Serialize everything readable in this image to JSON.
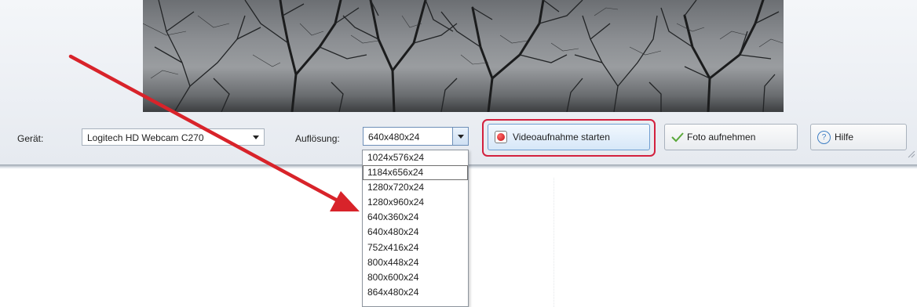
{
  "toolbar": {
    "device_label": "Gerät:",
    "device_value": "Logitech HD Webcam C270",
    "resolution_label": "Auflösung:",
    "resolution_value": "640x480x24",
    "record_button": "Videoaufnahme starten",
    "photo_button": "Foto aufnehmen",
    "help_button": "Hilfe"
  },
  "resolution_options": [
    "1024x576x24",
    "1184x656x24",
    "1280x720x24",
    "1280x960x24",
    "640x360x24",
    "640x480x24",
    "752x416x24",
    "800x448x24",
    "800x600x24",
    "864x480x24"
  ],
  "highlighted_option": "1184x656x24",
  "colors": {
    "highlight_box": "#d3213e",
    "arrow": "#d8232a",
    "record_dot": "#c40f12",
    "photo_check": "#5aa83a",
    "help_icon": "#3f7fc4"
  },
  "icons": {
    "record": "record-icon",
    "photo": "checkmark-icon",
    "help": "question-circle-icon"
  }
}
